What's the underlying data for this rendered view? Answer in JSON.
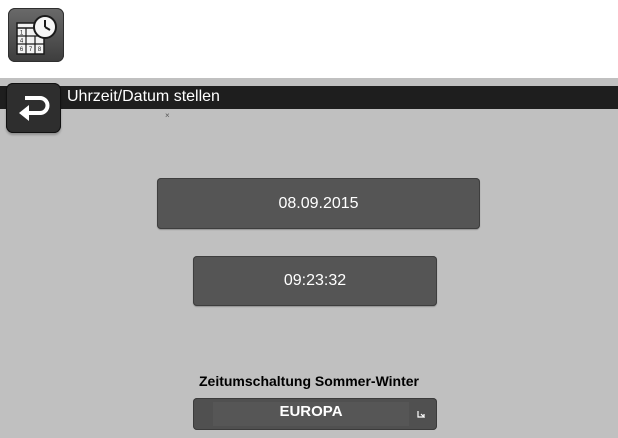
{
  "app_icon": {
    "icon": "clock-calendar-icon",
    "calendar_digits": [
      "1",
      "4",
      "6",
      "7",
      "8"
    ]
  },
  "header": {
    "title": "Uhrzeit/Datum stellen",
    "back_icon": "return-arrow-icon"
  },
  "mark": "×",
  "date": {
    "value": "08.09.2015"
  },
  "time": {
    "value": "09:23:32"
  },
  "dst": {
    "label": "Zeitumschaltung Sommer-Winter",
    "selected": "EUROPA",
    "dropdown_icon": "select-arrow-icon"
  },
  "colors": {
    "screen_background": "#c0c0c0",
    "title_bar": "#1e1e1e",
    "button": "#555555",
    "text_light": "#ffffff"
  }
}
